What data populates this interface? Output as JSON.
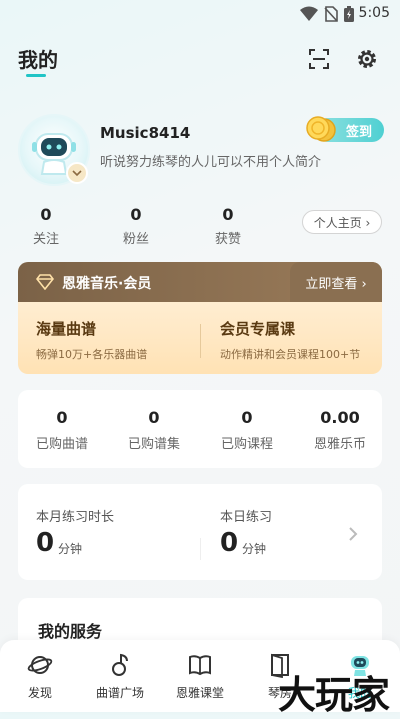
{
  "status_bar": {
    "time": "5:05"
  },
  "header": {
    "title": "我的"
  },
  "profile": {
    "username": "Music8414",
    "bio": "听说努力练琴的人儿可以不用个人简介",
    "checkin_label": "签到",
    "stats": [
      {
        "value": "0",
        "label": "关注"
      },
      {
        "value": "0",
        "label": "粉丝"
      },
      {
        "value": "0",
        "label": "获赞"
      }
    ],
    "home_button": "个人主页 ›"
  },
  "vip": {
    "title": "恩雅音乐·会员",
    "cta": "立即查看 ›",
    "features": [
      {
        "title": "海量曲谱",
        "subtitle": "畅弹10万+各乐器曲谱"
      },
      {
        "title": "会员专属课",
        "subtitle": "动作精讲和会员课程100+节"
      }
    ]
  },
  "purchases": [
    {
      "value": "0",
      "label": "已购曲谱"
    },
    {
      "value": "0",
      "label": "已购谱集"
    },
    {
      "value": "0",
      "label": "已购课程"
    },
    {
      "value": "0.00",
      "label": "恩雅乐币"
    }
  ],
  "practice": {
    "month": {
      "label": "本月练习时长",
      "value": "0",
      "unit": "分钟"
    },
    "today": {
      "label": "本日练习",
      "value": "0",
      "unit": "分钟"
    }
  },
  "services": {
    "title": "我的服务"
  },
  "bottom_nav": [
    {
      "label": "发现",
      "icon": "planet-icon"
    },
    {
      "label": "曲谱广场",
      "icon": "music-note-icon"
    },
    {
      "label": "恩雅课堂",
      "icon": "book-icon"
    },
    {
      "label": "琴房",
      "icon": "door-icon"
    },
    {
      "label": "我的",
      "icon": "robot-avatar-icon"
    }
  ],
  "watermark": "大玩家",
  "colors": {
    "accent": "#20c4c6",
    "vip_brown": "#7b6247",
    "vip_text": "#5a3a12"
  }
}
